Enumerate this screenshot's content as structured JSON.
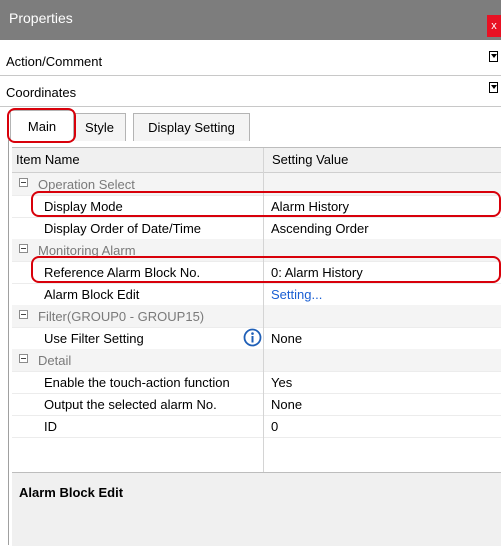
{
  "window": {
    "title": "Properties",
    "close_glyph": "x"
  },
  "sections": [
    {
      "label": "Action/Comment"
    },
    {
      "label": "Coordinates"
    }
  ],
  "tabs": [
    {
      "label": "Main",
      "active": true
    },
    {
      "label": "Style",
      "active": false
    },
    {
      "label": "Display Setting",
      "active": false
    }
  ],
  "grid": {
    "col_name": "Item Name",
    "col_value": "Setting Value",
    "rows": [
      {
        "type": "category",
        "label": "Operation Select"
      },
      {
        "type": "prop",
        "name": "Display Mode",
        "value": "Alarm History",
        "highlighted": true
      },
      {
        "type": "prop",
        "name": "Display Order of Date/Time",
        "value": "Ascending Order"
      },
      {
        "type": "category",
        "label": "Monitoring Alarm"
      },
      {
        "type": "prop",
        "name": "Reference Alarm Block No.",
        "value": "0: Alarm History",
        "highlighted": true
      },
      {
        "type": "prop",
        "name": "Alarm Block Edit",
        "value": "Setting...",
        "link": true
      },
      {
        "type": "category",
        "label": "Filter(GROUP0 - GROUP15)"
      },
      {
        "type": "prop",
        "name": "Use Filter Setting",
        "value": "None",
        "icon": "info-icon"
      },
      {
        "type": "category",
        "label": "Detail"
      },
      {
        "type": "prop",
        "name": "Enable the touch-action function",
        "value": "Yes"
      },
      {
        "type": "prop",
        "name": "Output the selected alarm No.",
        "value": "None"
      },
      {
        "type": "prop",
        "name": "ID",
        "value": "0"
      }
    ]
  },
  "description": {
    "title": "Alarm Block Edit"
  },
  "colors": {
    "titlebar": "#7d7d7d",
    "highlight": "#d8000a",
    "link": "#1a5fd3",
    "close": "#e81123"
  }
}
